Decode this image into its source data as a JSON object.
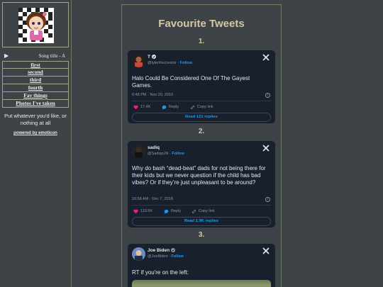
{
  "sidebar": {
    "song": {
      "play_symbol": "▶",
      "title": "Song title - A"
    },
    "nav": [
      {
        "label": "first"
      },
      {
        "label": "second"
      },
      {
        "label": "third"
      },
      {
        "label": "fourth"
      },
      {
        "label": "Fav things"
      },
      {
        "label": "Photos I've taken"
      }
    ],
    "blurb": "Put whatever you'd like, or nothing at all",
    "powered": "powered by emoticon"
  },
  "main": {
    "title": "Favourite Tweets",
    "tweets": [
      {
        "number": "1.",
        "name": "T",
        "handle": "@tylerthecreator",
        "follow": "Follow",
        "text": "Halo Could Be Considered One Of The Gayest Games.",
        "time": "6:48 PM · Nov 20, 2010",
        "likes": "17.4K",
        "reply": "Reply",
        "copy": "Copy link",
        "read": "Read 121 replies"
      },
      {
        "number": "2.",
        "name": "sadiq",
        "handle": "@SadiqoJN",
        "follow": "Follow",
        "text": "Why do bash “dead-beat” dads for not being there for their kids but we never question if the child has bad vibes? Or if they’re just unpleasant to be around?",
        "time": "10:58 AM · Dec 7, 2018",
        "likes": "110.5K",
        "reply": "Reply",
        "copy": "Copy link",
        "read": "Read 2.9K replies"
      },
      {
        "number": "3.",
        "name": "Joe Biden",
        "handle": "@JoeBiden",
        "follow": "Follow",
        "text": "RT if you're on the left:"
      }
    ]
  },
  "colors": {
    "background": "#3d4347",
    "heading": "#d7c7a3",
    "card": "#17202c",
    "link_blue": "#1d9bf0",
    "heart_pink": "#f91880"
  }
}
